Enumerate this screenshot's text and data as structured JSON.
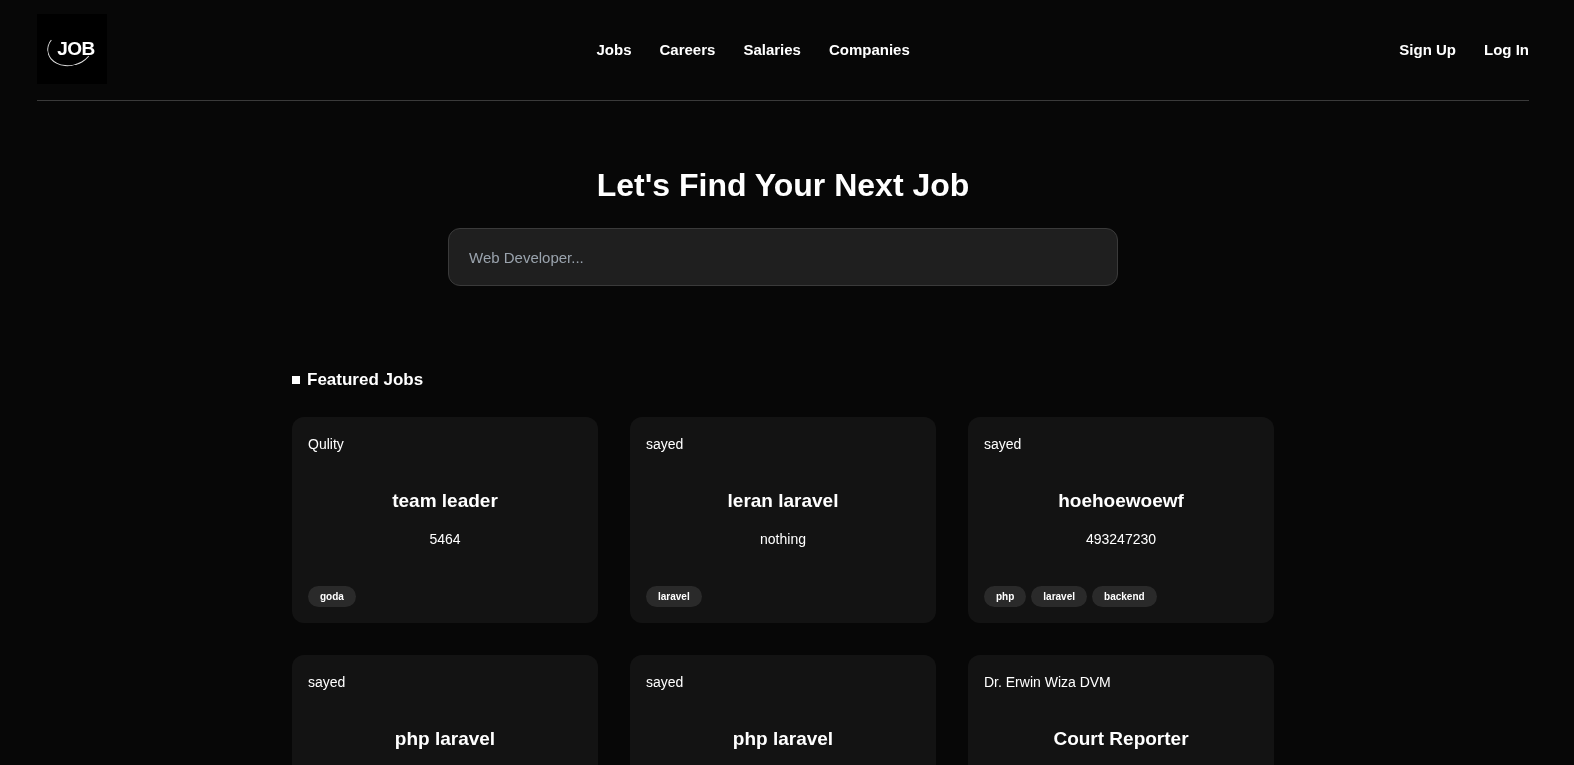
{
  "header": {
    "logo": "JOB",
    "nav": [
      "Jobs",
      "Careers",
      "Salaries",
      "Companies"
    ],
    "auth": [
      "Sign Up",
      "Log In"
    ]
  },
  "hero": {
    "title": "Let's Find Your Next Job",
    "search": {
      "placeholder": "Web Developer..."
    }
  },
  "featured": {
    "title": "Featured Jobs",
    "jobs": [
      {
        "company": "Qulity",
        "title": "team leader",
        "salary": "5464",
        "tags": [
          "goda"
        ]
      },
      {
        "company": "sayed",
        "title": "leran laravel",
        "salary": "nothing",
        "tags": [
          "laravel"
        ]
      },
      {
        "company": "sayed",
        "title": "hoehoewoewf",
        "salary": "493247230",
        "tags": [
          "php",
          "laravel",
          "backend"
        ]
      },
      {
        "company": "sayed",
        "title": "php laravel"
      },
      {
        "company": "sayed",
        "title": "php laravel"
      },
      {
        "company": "Dr. Erwin Wiza DVM",
        "title": "Court Reporter"
      }
    ]
  }
}
